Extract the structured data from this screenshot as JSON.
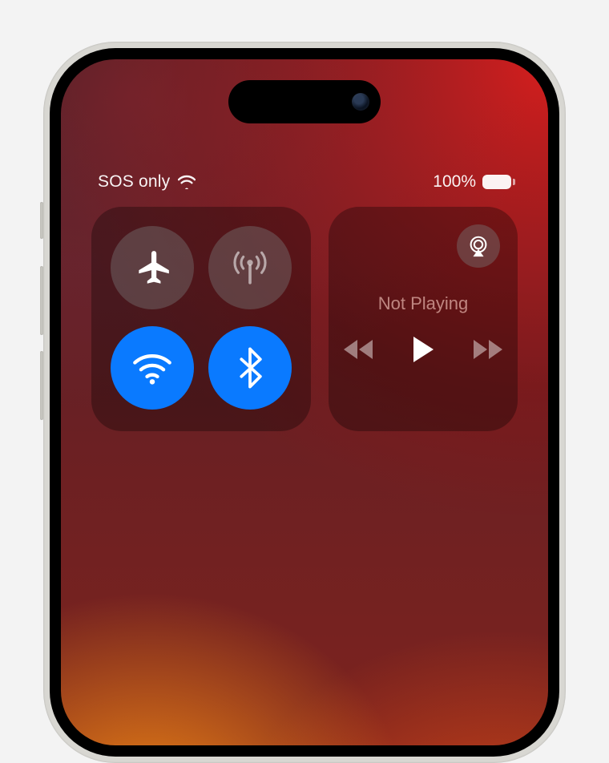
{
  "status": {
    "carrier_text": "SOS only",
    "battery_text": "100%"
  },
  "media": {
    "now_playing_text": "Not Playing"
  },
  "icons": {
    "airplane": "airplane-icon",
    "cellular_antenna": "cellular-antenna-icon",
    "wifi": "wifi-icon",
    "bluetooth": "bluetooth-icon",
    "airplay": "airplay-icon",
    "rewind": "rewind-icon",
    "play": "play-icon",
    "forward": "forward-icon",
    "battery": "battery-icon"
  },
  "colors": {
    "toggle_on": "#0a7aff",
    "toggle_off_bg": "rgba(120,120,120,.42)"
  }
}
